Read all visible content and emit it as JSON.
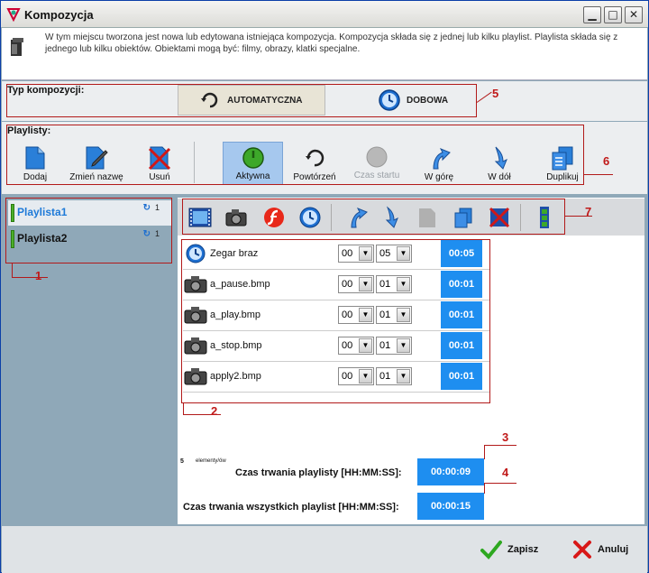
{
  "window": {
    "title": "Kompozycja",
    "min_icon": "minimize-icon",
    "max_icon": "maximize-icon",
    "close_icon": "close-icon"
  },
  "info": {
    "text": "W tym miejscu tworzona jest nowa lub edytowana istniejąca kompozycja. Kompozycja składa się z jednej lub kilku playlist. Playlista składa się z jednego lub kilku obiektów. Obiektami mogą być: filmy, obrazy, klatki specjalne."
  },
  "typ": {
    "label": "Typ kompozycji:",
    "options": [
      "AUTOMATYCZNA",
      "DOBOWA"
    ],
    "selected": "AUTOMATYCZNA"
  },
  "playlisty": {
    "label": "Playlisty:",
    "buttons": [
      {
        "label": "Dodaj",
        "icon": "document-icon"
      },
      {
        "label": "Zmień nazwę",
        "icon": "edit-icon"
      },
      {
        "label": "Usuń",
        "icon": "delete-icon"
      },
      {
        "label": "Aktywna",
        "icon": "power-icon",
        "pressed": true
      },
      {
        "label": "Powtórzeń",
        "icon": "repeat-icon"
      },
      {
        "label": "Czas startu",
        "icon": "clock-disabled-icon",
        "disabled": true
      },
      {
        "label": "W górę",
        "icon": "arrow-up-icon"
      },
      {
        "label": "W dół",
        "icon": "arrow-down-icon"
      },
      {
        "label": "Duplikuj",
        "icon": "duplicate-icon"
      }
    ]
  },
  "playlist_list": [
    {
      "name": "Playlista1",
      "count": "1",
      "selected": true
    },
    {
      "name": "Playlista2",
      "count": "1",
      "selected": false
    }
  ],
  "items": [
    {
      "name": "Zegar braz",
      "icon": "clock-icon",
      "min": "00",
      "sec": "05",
      "duration": "00:05"
    },
    {
      "name": "a_pause.bmp",
      "icon": "camera-icon",
      "min": "00",
      "sec": "01",
      "duration": "00:01"
    },
    {
      "name": "a_play.bmp",
      "icon": "camera-icon",
      "min": "00",
      "sec": "01",
      "duration": "00:01"
    },
    {
      "name": "a_stop.bmp",
      "icon": "camera-icon",
      "min": "00",
      "sec": "01",
      "duration": "00:01"
    },
    {
      "name": "apply2.bmp",
      "icon": "camera-icon",
      "min": "00",
      "sec": "01",
      "duration": "00:01"
    }
  ],
  "elements_count": {
    "count": "5",
    "label": "elementy/ów"
  },
  "durations": {
    "playlist_label": "Czas trwania playlisty [HH:MM:SS]:",
    "playlist_value": "00:00:09",
    "all_label": "Czas trwania wszystkich playlist [HH:MM:SS]:",
    "all_value": "00:00:15"
  },
  "footer": {
    "save": "Zapisz",
    "cancel": "Anuluj"
  },
  "annotations": [
    "1",
    "2",
    "3",
    "4",
    "5",
    "6",
    "7"
  ],
  "colors": {
    "accent": "#1e8ef0",
    "annotation": "#c01818",
    "active_playlist": "#1e7ad8"
  }
}
